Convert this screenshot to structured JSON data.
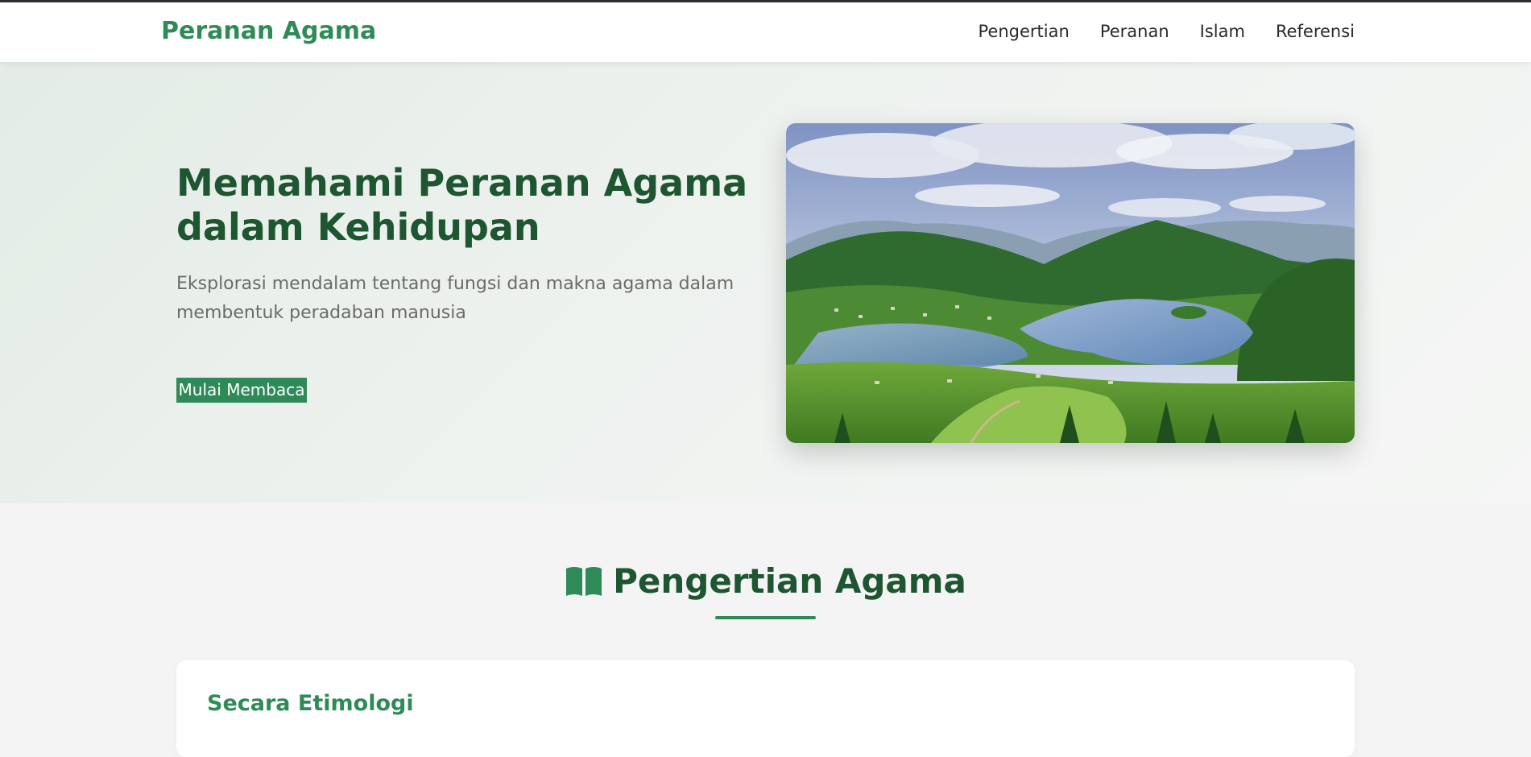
{
  "navbar": {
    "brand": "Peranan Agama",
    "links": [
      "Pengertian",
      "Peranan",
      "Islam",
      "Referensi"
    ]
  },
  "hero": {
    "title": "Memahami Peranan Agama dalam Kehidupan",
    "subtitle": "Eksplorasi mendalam tentang fungsi dan makna agama dalam membentuk peradaban manusia",
    "cta_label": "Mulai Membaca"
  },
  "section": {
    "title": "Pengertian Agama",
    "icon": "book-open-icon",
    "card_title": "Secara Etimologi"
  },
  "colors": {
    "brand": "#2e8b57",
    "heading": "#1e5631",
    "text_muted": "#6b6b6b",
    "hero_bg": "#e8efea",
    "page_bg": "#f4f4f4"
  }
}
